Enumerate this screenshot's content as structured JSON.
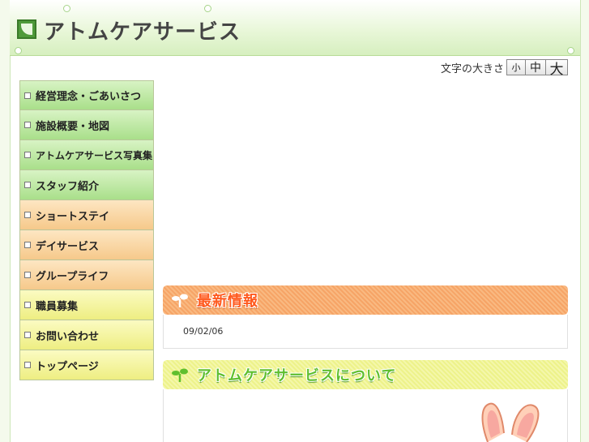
{
  "site": {
    "title": "アトムケアサービス"
  },
  "font_size": {
    "label": "文字の大きさ",
    "small": "小",
    "medium": "中",
    "large": "大"
  },
  "nav": {
    "items": [
      {
        "label": "経営理念・ごあいさつ",
        "color": "green"
      },
      {
        "label": "施設概要・地図",
        "color": "green"
      },
      {
        "label": "アトムケアサービス写真集",
        "color": "green"
      },
      {
        "label": "スタッフ紹介",
        "color": "green"
      },
      {
        "label": "ショートステイ",
        "color": "orange"
      },
      {
        "label": "デイサービス",
        "color": "orange"
      },
      {
        "label": "グループライフ",
        "color": "orange"
      },
      {
        "label": "職員募集",
        "color": "yellow"
      },
      {
        "label": "お問い合わせ",
        "color": "yellow"
      },
      {
        "label": "トップページ",
        "color": "yellow"
      }
    ]
  },
  "news": {
    "heading": "最新情報",
    "date": "09/02/06"
  },
  "about": {
    "heading": "アトムケアサービスについて"
  },
  "colors": {
    "accent_green": "#5fbf2e",
    "accent_orange": "#ff5a1f",
    "header_bg": "#e9f7d9"
  }
}
